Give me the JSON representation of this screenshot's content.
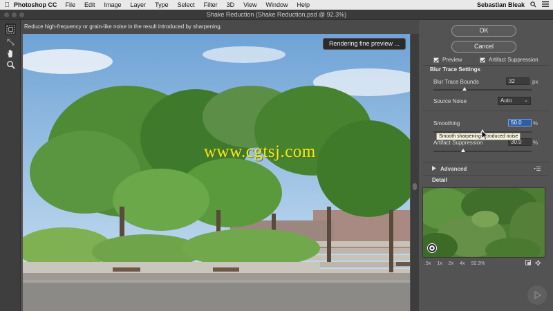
{
  "menubar": {
    "app_name": "Photoshop CC",
    "items": [
      "File",
      "Edit",
      "Image",
      "Layer",
      "Type",
      "Select",
      "Filter",
      "3D",
      "View",
      "Window",
      "Help"
    ],
    "user": "Sebastian Bleak"
  },
  "window": {
    "title": "Shake Reduction (Shake Reduction.psd @ 92.3%)"
  },
  "hint": "Reduce high-frequency or grain-like noise in the result introduced by sharpening.",
  "preview": {
    "badge": "Rendering fine preview ...",
    "watermark": "www.cgtsj.com"
  },
  "panel": {
    "ok_label": "OK",
    "cancel_label": "Cancel",
    "preview_label": "Preview",
    "preview_checked": true,
    "artifact_label": "Artifact Suppression",
    "artifact_checked": true,
    "blur_trace_heading": "Blur Trace Settings",
    "blur_trace_bounds": {
      "label": "Blur Trace Bounds",
      "value": "32",
      "unit": "px",
      "fraction": 0.32
    },
    "source_noise": {
      "label": "Source Noise",
      "value": "Auto"
    },
    "smoothing": {
      "label": "Smoothing",
      "value": "50.0",
      "unit": "%",
      "fraction": 0.5
    },
    "artifact_suppression": {
      "label": "Artifact Suppression",
      "value": "30.0",
      "unit": "%",
      "fraction": 0.3
    },
    "tooltip": "Smooth sharpening-introduced noise",
    "advanced_label": "Advanced",
    "detail_label": "Detail",
    "zoom_levels": [
      ".5x",
      "1x",
      "2x",
      "4x",
      "92.3%"
    ]
  },
  "colors": {
    "accent_field": "#2f5ea8",
    "watermark": "#f0f000",
    "panel_bg": "#535353"
  }
}
